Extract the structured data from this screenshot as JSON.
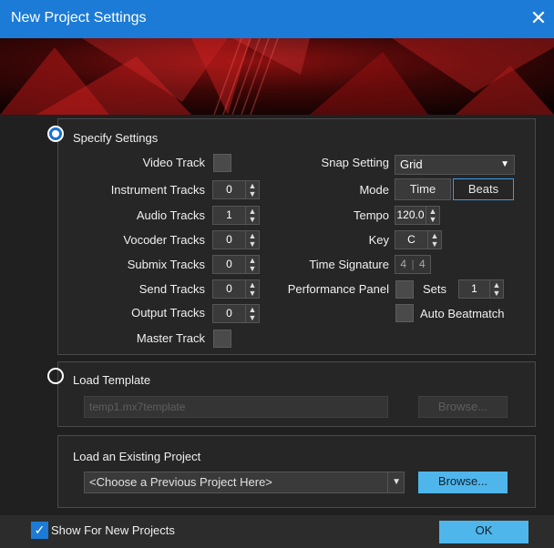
{
  "window": {
    "title": "New Project Settings",
    "close_glyph": "✕"
  },
  "specify": {
    "label": "Specify Settings",
    "selected": true,
    "left_rows": [
      {
        "label": "Video Track",
        "kind": "check"
      },
      {
        "label": "Instrument Tracks",
        "kind": "spin",
        "value": "0"
      },
      {
        "label": "Audio Tracks",
        "kind": "spin",
        "value": "1"
      },
      {
        "label": "Vocoder Tracks",
        "kind": "spin",
        "value": "0"
      },
      {
        "label": "Submix Tracks",
        "kind": "spin",
        "value": "0"
      },
      {
        "label": "Send Tracks",
        "kind": "spin",
        "value": "0"
      },
      {
        "label": "Output Tracks",
        "kind": "spin",
        "value": "0"
      },
      {
        "label": "Master Track",
        "kind": "check"
      }
    ],
    "snap": {
      "label": "Snap Setting",
      "value": "Grid"
    },
    "mode": {
      "label": "Mode",
      "time": "Time",
      "beats": "Beats",
      "selected": "Beats"
    },
    "tempo": {
      "label": "Tempo",
      "value": "120.0"
    },
    "key": {
      "label": "Key",
      "value": "C"
    },
    "time_signature": {
      "label": "Time Signature",
      "numerator": "4",
      "separator": "|",
      "denominator": "4"
    },
    "performance": {
      "label": "Performance Panel",
      "sets_label": "Sets",
      "sets_value": "1"
    },
    "auto_beatmatch": {
      "label": "Auto Beatmatch"
    }
  },
  "template": {
    "label": "Load Template",
    "selected": false,
    "value": "temp1.mx7template",
    "browse_label": "Browse..."
  },
  "existing": {
    "label": "Load an Existing Project",
    "placeholder": "<Choose a Previous Project Here>",
    "browse_label": "Browse..."
  },
  "footer": {
    "show_label": "Show For New Projects",
    "show_checked": true,
    "ok_label": "OK"
  },
  "colors": {
    "accent": "#1c7bd6",
    "button_blue": "#4fb6ec",
    "selected_border": "#3d9be9"
  }
}
